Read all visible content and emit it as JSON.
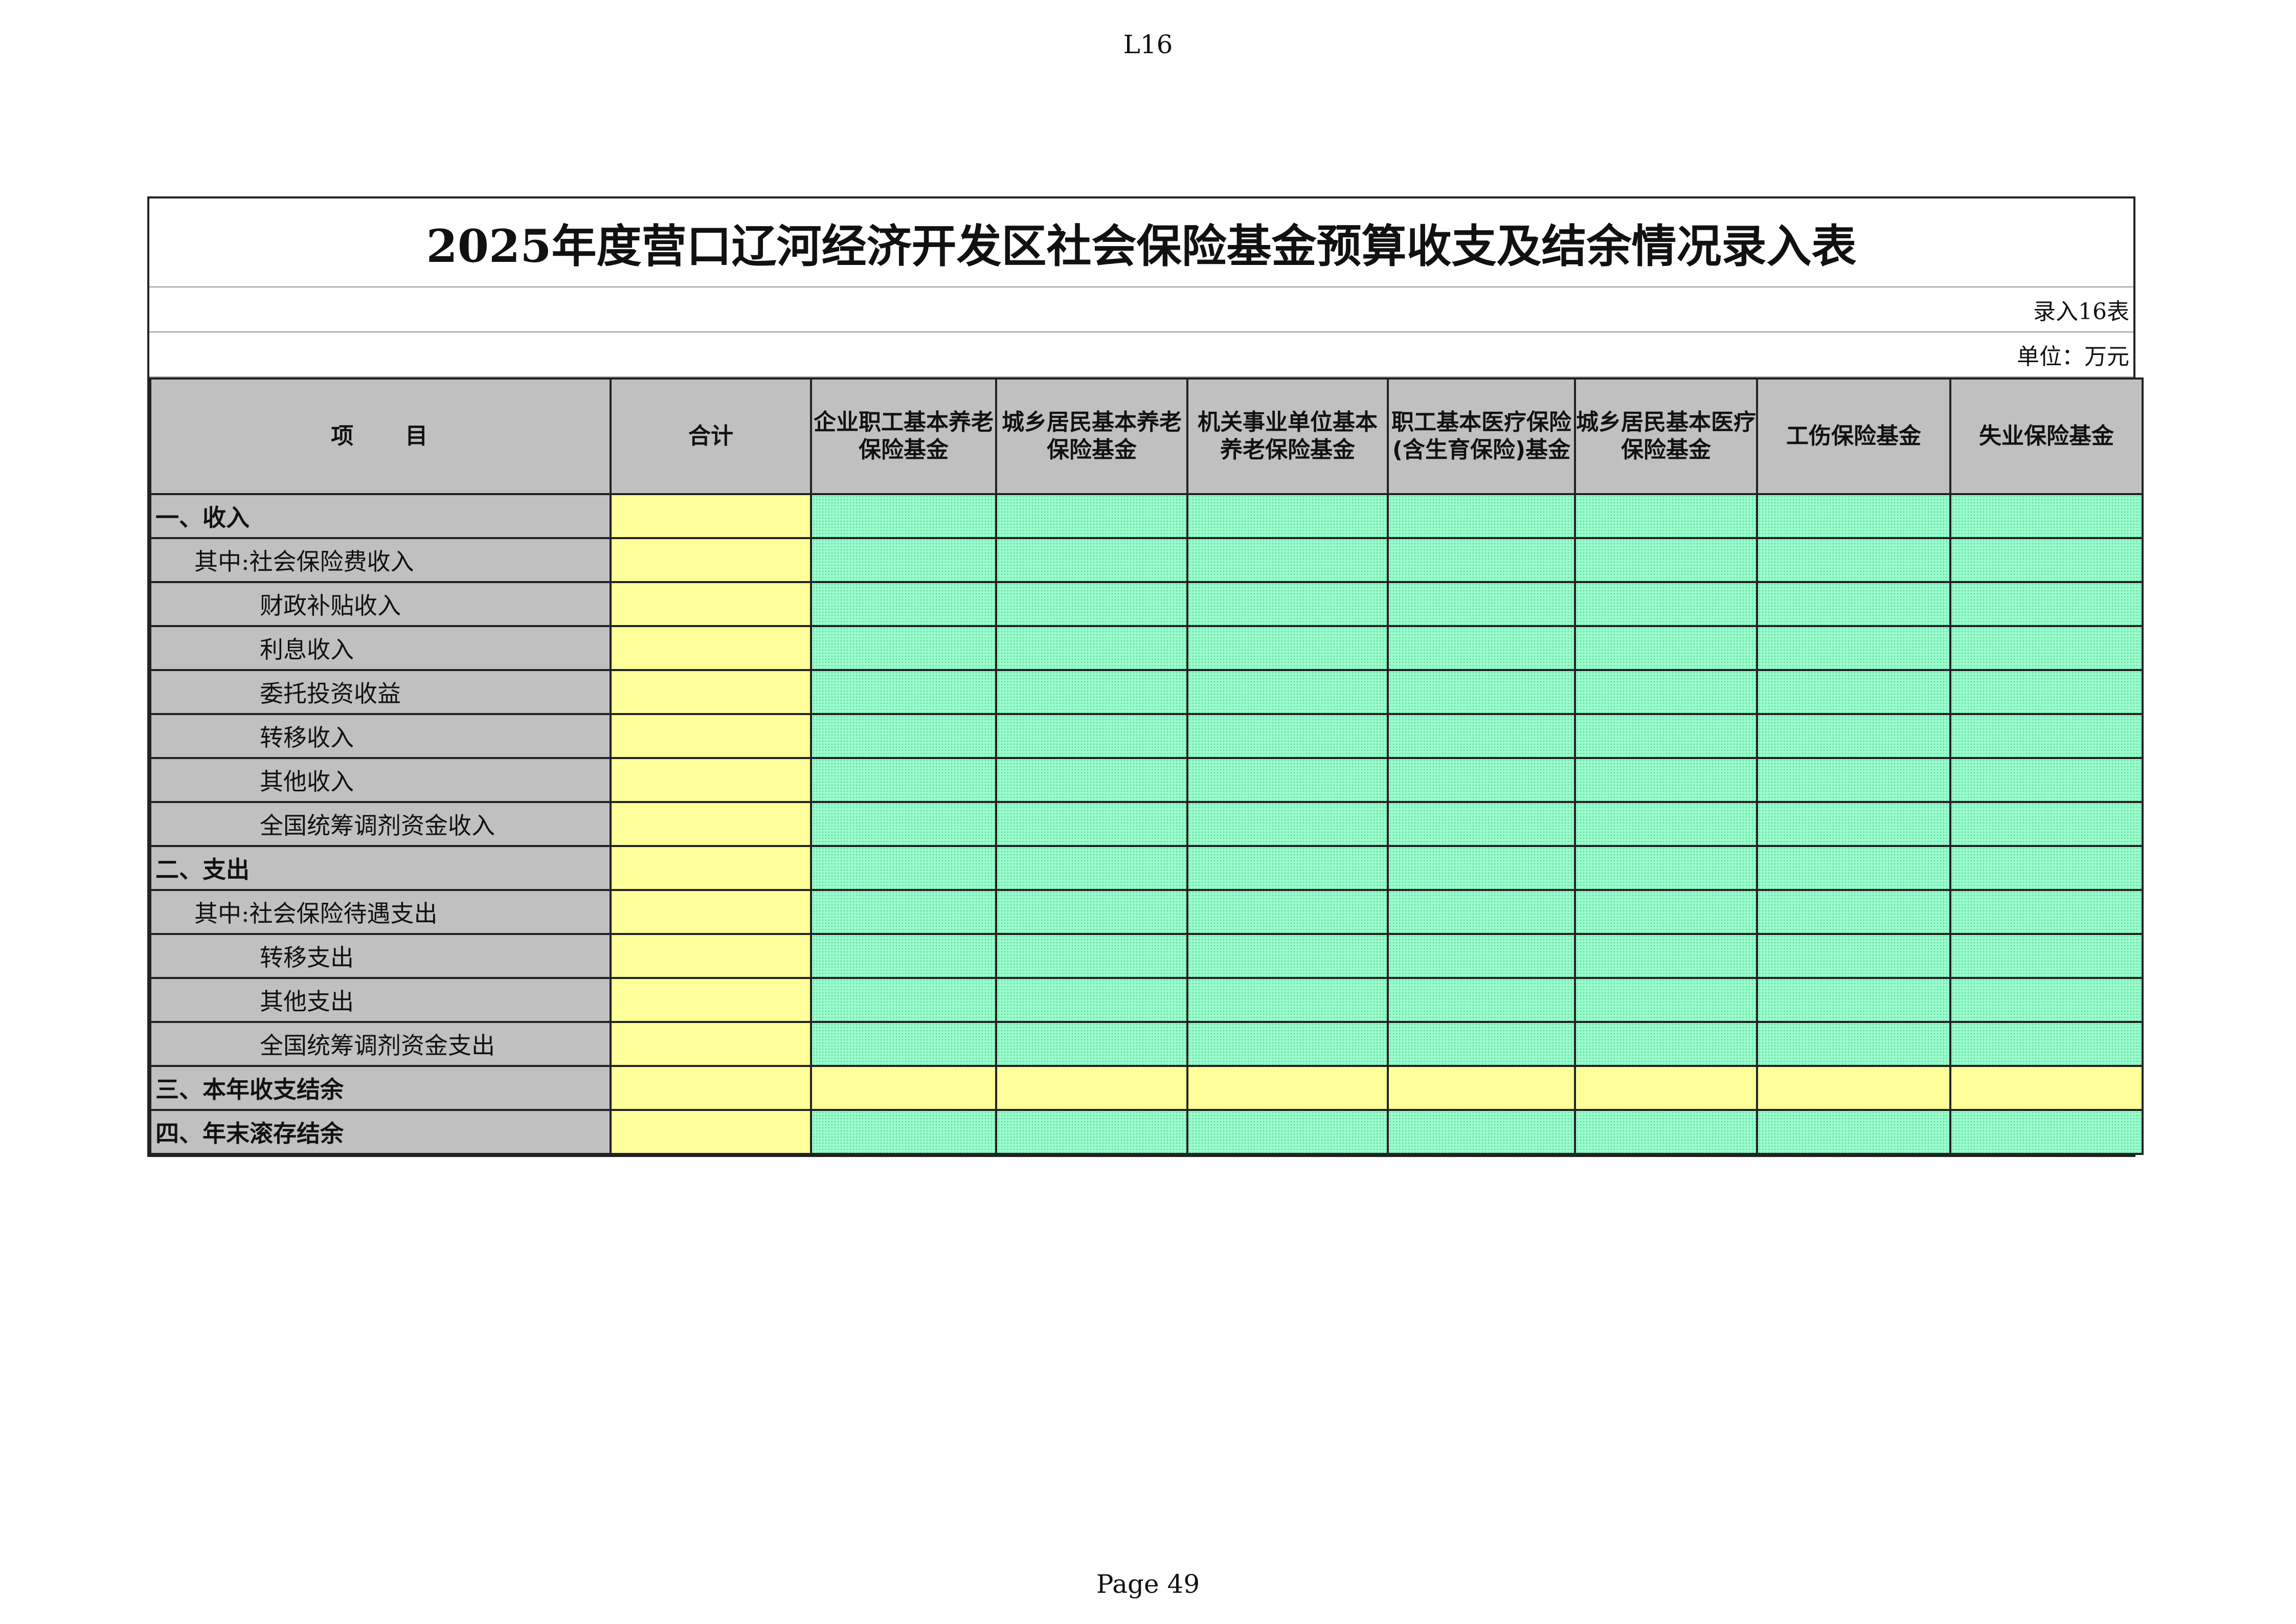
{
  "page": {
    "code": "L16",
    "page_number": "Page 49"
  },
  "sheet": {
    "title": "2025年度营口辽河经济开发区社会保险基金预算收支及结余情况录入表",
    "form_number": "录入16表",
    "unit": "单位：万元"
  },
  "table": {
    "headers": [
      "项　　目",
      "合计",
      "企业职工基本养老保险基金",
      "城乡居民基本养老保险基金",
      "机关事业单位基本养老保险基金",
      "职工基本医疗保险(含生育保险)基金",
      "城乡居民基本医疗保险基金",
      "工伤保险基金",
      "失业保险基金"
    ],
    "rows": [
      {
        "label": "一、收入",
        "level": 0,
        "fill": "green"
      },
      {
        "label": "其中:社会保险费收入",
        "level": 1,
        "fill": "green"
      },
      {
        "label": "财政补贴收入",
        "level": 2,
        "fill": "green"
      },
      {
        "label": "利息收入",
        "level": 2,
        "fill": "green"
      },
      {
        "label": "委托投资收益",
        "level": 2,
        "fill": "green"
      },
      {
        "label": "转移收入",
        "level": 2,
        "fill": "green"
      },
      {
        "label": "其他收入",
        "level": 2,
        "fill": "green"
      },
      {
        "label": "全国统筹调剂资金收入",
        "level": 2,
        "fill": "green"
      },
      {
        "label": "二、支出",
        "level": 0,
        "fill": "green"
      },
      {
        "label": "其中:社会保险待遇支出",
        "level": 1,
        "fill": "green"
      },
      {
        "label": "转移支出",
        "level": 2,
        "fill": "green"
      },
      {
        "label": "其他支出",
        "level": 2,
        "fill": "green"
      },
      {
        "label": "全国统筹调剂资金支出",
        "level": 2,
        "fill": "green"
      },
      {
        "label": "三、本年收支结余",
        "level": 0,
        "fill": "yellow"
      },
      {
        "label": "四、年末滚存结余",
        "level": 0,
        "fill": "green"
      }
    ]
  },
  "colors": {
    "header_gray": "#c0c0c0",
    "total_yellow": "#ffff99",
    "input_green": "#99ffcc"
  }
}
